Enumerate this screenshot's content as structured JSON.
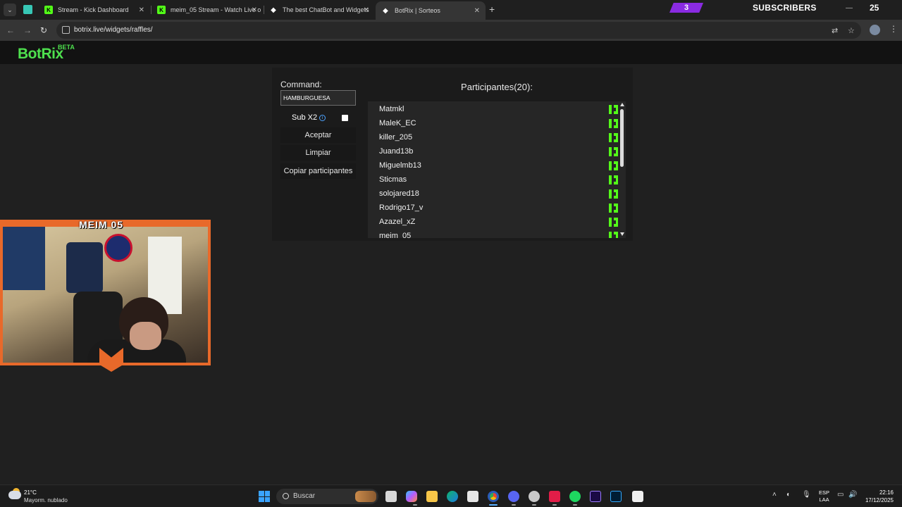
{
  "browser": {
    "tabs": [
      {
        "title": "Stream - Kick Dashboard",
        "active": false
      },
      {
        "title": "meim_05 Stream - Watch Live o",
        "active": false
      },
      {
        "title": "The best ChatBot and Widgets",
        "active": false
      },
      {
        "title": "BotRix | Sorteos",
        "active": true
      }
    ],
    "new_tab_label": "+",
    "url": "botrix.live/widgets/raffles/"
  },
  "overlay": {
    "subs_goal": "3",
    "subs_label": "SUBSCRIBERS",
    "subs_count": "25",
    "cam_title": "MEIM 05"
  },
  "app": {
    "logo": "BotRix",
    "beta": "BETA"
  },
  "raffle": {
    "command_label": "Command:",
    "command_value": "HAMBURGUESA",
    "sub_label": "Sub X2",
    "accept_label": "Aceptar",
    "clear_label": "Limpiar",
    "copy_label": "Copiar participantes",
    "participants_title": "Participantes(20):",
    "participants": [
      "Matmkl",
      "MaleK_EC",
      "killer_205",
      "Juand13b",
      "Miguelmb13",
      "Sticmas",
      "solojared18",
      "Rodrigo17_v",
      "Azazel_xZ",
      "meim_05"
    ]
  },
  "taskbar": {
    "temp": "21°C",
    "weather": "Mayorm. nublado",
    "search": "Buscar",
    "lang_1": "ESP",
    "lang_2": "LAA",
    "time": "22:16",
    "date": "17/12/2025"
  },
  "colors": {
    "kick_green": "#53fc18",
    "botrix_green": "#4ee04e",
    "overlay_orange": "#e8692a",
    "subs_purple": "#8a2be2"
  }
}
